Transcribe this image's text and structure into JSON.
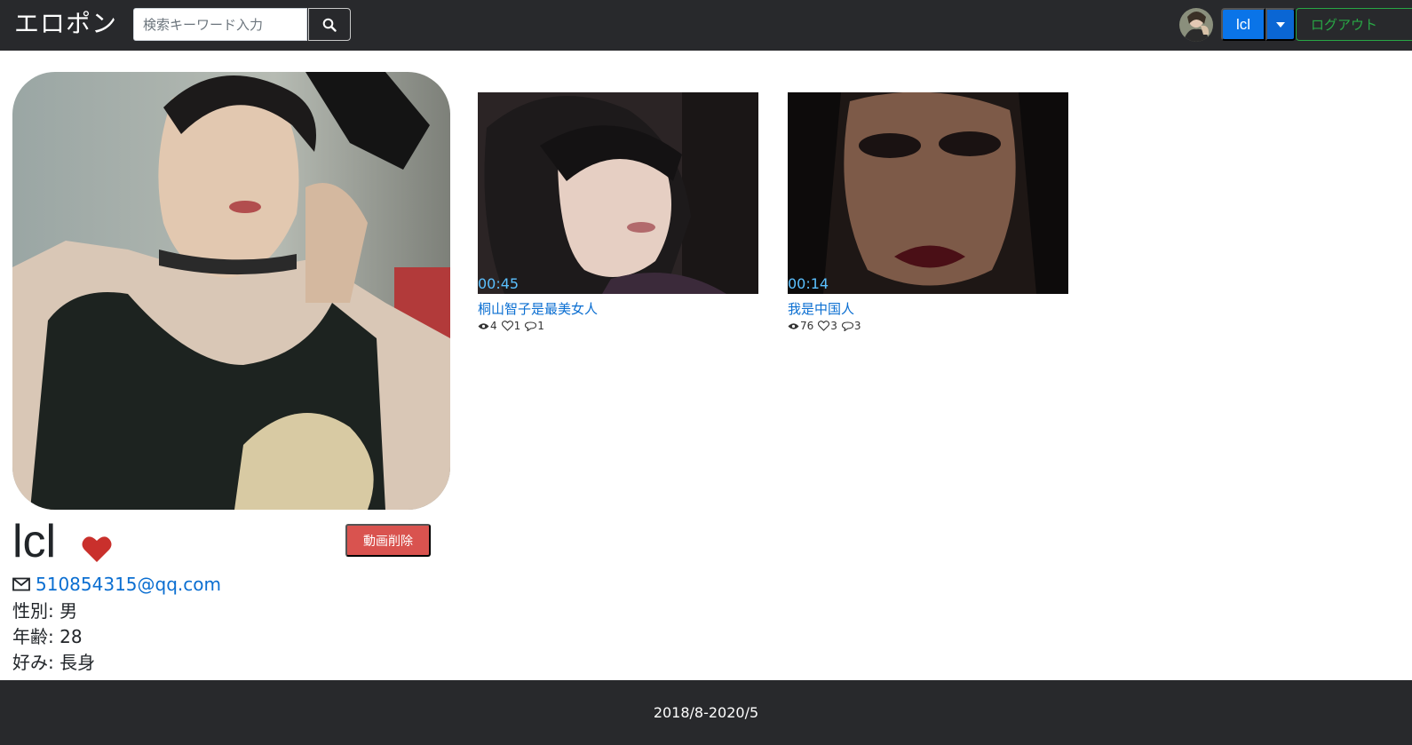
{
  "header": {
    "brand": "エロポン",
    "search_placeholder": "検索キーワード入力",
    "user_label": "lcl",
    "logout_label": "ログアウト"
  },
  "profile": {
    "username": "lcl",
    "delete_label": "動画削除",
    "email": "510854315@qq.com",
    "gender": "性別: 男",
    "age": "年齢: 28",
    "preference": "好み: 長身"
  },
  "videos": [
    {
      "duration": "00:45",
      "title": "桐山智子是最美女人",
      "views": "4",
      "likes": "1",
      "comments": "1"
    },
    {
      "duration": "00:14",
      "title": "我是中国人",
      "views": "76",
      "likes": "3",
      "comments": "3"
    }
  ],
  "footer": {
    "text": "2018/8-2020/5"
  },
  "colors": {
    "navbar": "#28292c",
    "primary": "#0a74e8",
    "success": "#28a745",
    "danger": "#d9534f",
    "link": "#0a6ed1",
    "heart": "#c9302c",
    "duration": "#5bc0ff"
  },
  "icons": [
    "search-icon",
    "avatar",
    "caret-down-icon",
    "heart-icon",
    "envelope-icon",
    "eye-icon",
    "heart-outline-icon",
    "comment-icon"
  ]
}
